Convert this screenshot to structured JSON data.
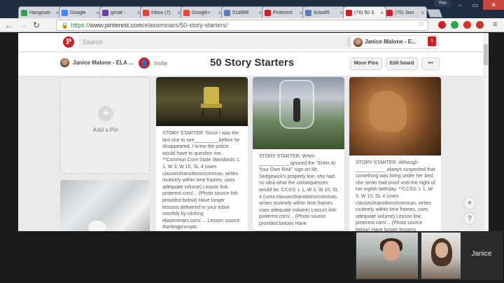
{
  "browser": {
    "tabs": [
      {
        "label": "Hangouts",
        "color": "#3c9a4e"
      },
      {
        "label": "Google",
        "color": "#4285f4"
      },
      {
        "label": "gmail -",
        "color": "#6b3fa0"
      },
      {
        "label": "Inbox (7)",
        "color": "#db4437"
      },
      {
        "label": "Google+",
        "color": "#dd4b39"
      },
      {
        "label": "51d988",
        "color": "#5b7db1"
      },
      {
        "label": "Pinterest",
        "color": "#cb2027"
      },
      {
        "label": "9cba95",
        "color": "#5b7db1"
      },
      {
        "label": "(76) 50 S",
        "color": "#cb2027"
      },
      {
        "label": "(76) Jani",
        "color": "#cb2027"
      }
    ],
    "window_user": "You",
    "address": {
      "protocol": "https://",
      "host": "www.pinterest.com",
      "path": "/elaseminars/50-story-starters/"
    },
    "extensions": [
      {
        "name": "pinterest-ext-icon",
        "color": "#cb2027"
      },
      {
        "name": "green-ext-icon",
        "color": "#2da44e"
      },
      {
        "name": "red-ext-icon",
        "color": "#d93025"
      },
      {
        "name": "adblock-ext-icon",
        "color": "#c0392b"
      }
    ]
  },
  "pinterest": {
    "search_placeholder": "Search",
    "user_pill": "Janice Malone - E...",
    "notification_count": "1"
  },
  "board": {
    "owner": "Janice Malone - ELA ...",
    "invite": "Invite",
    "title": "50 Story Starters",
    "buttons": {
      "move": "Move Pins",
      "edit": "Edit board",
      "more": "•••"
    }
  },
  "grid": {
    "add_pin": "Add a Pin",
    "pins": [
      {
        "desc": "STORY STARTER: Since I was the last one to see_________before he disappeared, I knew the police would have to question me. **Common Core State Standards: L 1, W 3, W 10, SL 4 (uses clauses/transitions/commas, writes routinely within time frames, uses adequate volume) Lesson link: pinterest.com/... (Photo source link provided below) Have longer lessons delivered to your inbox monthly by clicking elaseminars.com/.... Lesson source: #writingprompts"
      },
      {
        "desc": "STORY STARTER: When ___________ ignored the \"Enter At Your Own Risk\" sign on Mr. Sedgewick's property line, she had no idea what the consequences would be. CCSS: L 1, W 3, W 10, SL 4 (uses clauses/transitions/commas, writes routinely within time frames, uses adequate volume) Lesson link: pinterest.com/... (Photo source provided below) Have"
      },
      {
        "desc": "STORY STARTER: Although ___________ always suspected that something was living under her bed, she never had proof until the night of her eighth birthday. **CCSS: L 1, W 3, W 10, SL 4 (uses clauses/transitions/commas, writes routinely within time frames, uses adequate volume) Lesson link: pinterest.com/... (Photo source below) Have longer lessons"
      }
    ],
    "side_buttons": {
      "plus": "+",
      "help": "?"
    }
  },
  "video_call": {
    "participant": "Janice"
  }
}
